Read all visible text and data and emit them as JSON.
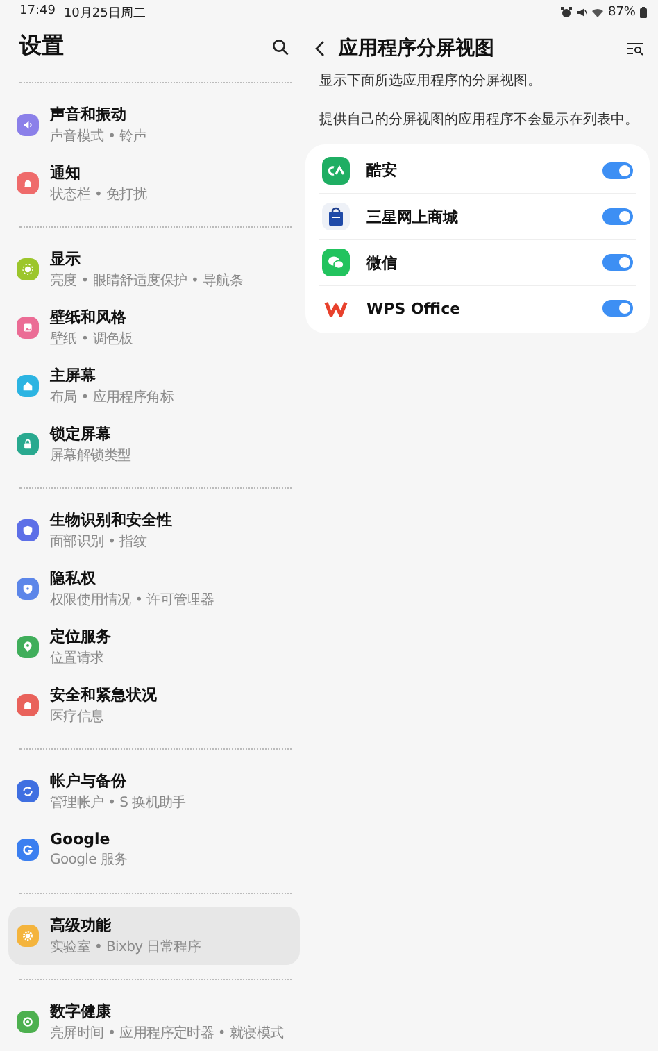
{
  "status_bar": {
    "time": "17:49",
    "date": "10月25日周二",
    "battery": "87%"
  },
  "sidebar": {
    "title": "设置",
    "groups": [
      {
        "items": [
          {
            "title": "声音和振动",
            "subtitle": "声音模式 • 铃声",
            "color": "#8b80e9",
            "selected": false
          },
          {
            "title": "通知",
            "subtitle": "状态栏 • 免打扰",
            "color": "#ef6b6b",
            "selected": false
          }
        ]
      },
      {
        "items": [
          {
            "title": "显示",
            "subtitle": "亮度 • 眼睛舒适度保护 • 导航条",
            "color": "#9cc62c",
            "selected": false
          },
          {
            "title": "壁纸和风格",
            "subtitle": "壁纸 • 调色板",
            "color": "#eb6c95",
            "selected": false
          },
          {
            "title": "主屏幕",
            "subtitle": "布局 • 应用程序角标",
            "color": "#2cb4e2",
            "selected": false
          },
          {
            "title": "锁定屏幕",
            "subtitle": "屏幕解锁类型",
            "color": "#29a98f",
            "selected": false
          }
        ]
      },
      {
        "items": [
          {
            "title": "生物识别和安全性",
            "subtitle": "面部识别 • 指纹",
            "color": "#5d6fe7",
            "selected": false
          },
          {
            "title": "隐私权",
            "subtitle": "权限使用情况 • 许可管理器",
            "color": "#5c86e9",
            "selected": false
          },
          {
            "title": "定位服务",
            "subtitle": "位置请求",
            "color": "#40ae5b",
            "selected": false
          },
          {
            "title": "安全和紧急状况",
            "subtitle": "医疗信息",
            "color": "#e9625b",
            "selected": false
          }
        ]
      },
      {
        "items": [
          {
            "title": "帐户与备份",
            "subtitle": "管理帐户 • S 换机助手",
            "color": "#3f6fe1",
            "selected": false
          },
          {
            "title": "Google",
            "subtitle": "Google 服务",
            "color": "#3b7ff0",
            "selected": false
          }
        ]
      },
      {
        "items": [
          {
            "title": "高级功能",
            "subtitle": "实验室 • Bixby 日常程序",
            "color": "#f4b43d",
            "selected": true
          }
        ]
      },
      {
        "items": [
          {
            "title": "数字健康",
            "subtitle": "亮屏时间 • 应用程序定时器 • 就寝模式",
            "color": "#4db04f",
            "selected": false
          }
        ]
      }
    ]
  },
  "detail": {
    "title": "应用程序分屏视图",
    "descriptions": [
      "显示下面所选应用程序的分屏视图。",
      "提供自己的分屏视图的应用程序不会显示在列表中。"
    ],
    "apps": [
      {
        "name": "酷安",
        "on": true
      },
      {
        "name": "三星网上商城",
        "on": true
      },
      {
        "name": "微信",
        "on": true
      },
      {
        "name": "WPS Office",
        "on": true
      }
    ]
  }
}
